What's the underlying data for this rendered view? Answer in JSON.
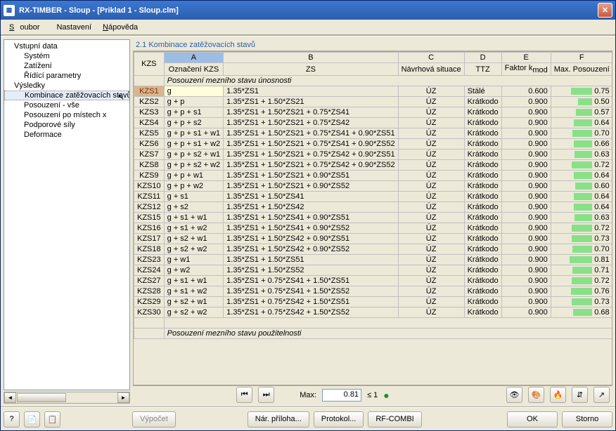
{
  "window": {
    "title": "RX-TIMBER - Sloup - [Priklad 1 - Sloup.clm]"
  },
  "menu": {
    "file": "Soubor",
    "settings": "Nastavení",
    "help": "Nápověda"
  },
  "tree": {
    "t0": "Vstupní data",
    "t1": "Systém",
    "t2": "Zatížení",
    "t3": "Řídící parametry",
    "t4": "Výsledky",
    "t5": "Kombinace zatěžovacích stavů",
    "t6": "Posouzení - vše",
    "t7": "Posouzení po místech x",
    "t8": "Podporové síly",
    "t9": "Deformace"
  },
  "panel_title": "2.1 Kombinace zatěžovacích stavů",
  "headers": {
    "kzs": "KZS",
    "A": "A",
    "B": "B",
    "C": "C",
    "D": "D",
    "E": "E",
    "F": "F",
    "ozn": "Označení KZS",
    "zs": "ZS",
    "ns": "Návrhová situace",
    "ttz": "TTZ",
    "faktor": "Faktor k",
    "faktor_sub": "mod",
    "max": "Max. Posouzení"
  },
  "section1": "Posouzení mezního stavu únosnosti",
  "section2": "Posouzení mezního stavu použitelnosti",
  "rows": [
    {
      "id": "KZS1",
      "a": "g",
      "b": "1.35*ZS1",
      "c": "ÚZ",
      "d": "Stálé",
      "e": "0.600",
      "f": "0.75"
    },
    {
      "id": "KZS2",
      "a": "g + p",
      "b": "1.35*ZS1 + 1.50*ZS21",
      "c": "ÚZ",
      "d": "Krátkodo",
      "e": "0.900",
      "f": "0.50"
    },
    {
      "id": "KZS3",
      "a": "g + p + s1",
      "b": "1.35*ZS1 + 1.50*ZS21 + 0.75*ZS41",
      "c": "ÚZ",
      "d": "Krátkodo",
      "e": "0.900",
      "f": "0.57"
    },
    {
      "id": "KZS4",
      "a": "g + p + s2",
      "b": "1.35*ZS1 + 1.50*ZS21 + 0.75*ZS42",
      "c": "ÚZ",
      "d": "Krátkodo",
      "e": "0.900",
      "f": "0.64"
    },
    {
      "id": "KZS5",
      "a": "g + p + s1 + w1",
      "b": "1.35*ZS1 + 1.50*ZS21 + 0.75*ZS41 + 0.90*ZS51",
      "c": "ÚZ",
      "d": "Krátkodo",
      "e": "0.900",
      "f": "0.70"
    },
    {
      "id": "KZS6",
      "a": "g + p + s1 + w2",
      "b": "1.35*ZS1 + 1.50*ZS21 + 0.75*ZS41 + 0.90*ZS52",
      "c": "ÚZ",
      "d": "Krátkodo",
      "e": "0.900",
      "f": "0.66"
    },
    {
      "id": "KZS7",
      "a": "g + p + s2 + w1",
      "b": "1.35*ZS1 + 1.50*ZS21 + 0.75*ZS42 + 0.90*ZS51",
      "c": "ÚZ",
      "d": "Krátkodo",
      "e": "0.900",
      "f": "0.63"
    },
    {
      "id": "KZS8",
      "a": "g + p + s2 + w2",
      "b": "1.35*ZS1 + 1.50*ZS21 + 0.75*ZS42 + 0.90*ZS52",
      "c": "ÚZ",
      "d": "Krátkodo",
      "e": "0.900",
      "f": "0.72"
    },
    {
      "id": "KZS9",
      "a": "g + p + w1",
      "b": "1.35*ZS1 + 1.50*ZS21 + 0.90*ZS51",
      "c": "ÚZ",
      "d": "Krátkodo",
      "e": "0.900",
      "f": "0.64"
    },
    {
      "id": "KZS10",
      "a": "g + p + w2",
      "b": "1.35*ZS1 + 1.50*ZS21 + 0.90*ZS52",
      "c": "ÚZ",
      "d": "Krátkodo",
      "e": "0.900",
      "f": "0.60"
    },
    {
      "id": "KZS11",
      "a": "g + s1",
      "b": "1.35*ZS1 + 1.50*ZS41",
      "c": "ÚZ",
      "d": "Krátkodo",
      "e": "0.900",
      "f": "0.64"
    },
    {
      "id": "KZS12",
      "a": "g + s2",
      "b": "1.35*ZS1 + 1.50*ZS42",
      "c": "ÚZ",
      "d": "Krátkodo",
      "e": "0.900",
      "f": "0.64"
    },
    {
      "id": "KZS15",
      "a": "g + s1 + w1",
      "b": "1.35*ZS1 + 1.50*ZS41 + 0.90*ZS51",
      "c": "ÚZ",
      "d": "Krátkodo",
      "e": "0.900",
      "f": "0.63"
    },
    {
      "id": "KZS16",
      "a": "g + s1 + w2",
      "b": "1.35*ZS1 + 1.50*ZS41 + 0.90*ZS52",
      "c": "ÚZ",
      "d": "Krátkodo",
      "e": "0.900",
      "f": "0.72"
    },
    {
      "id": "KZS17",
      "a": "g + s2 + w1",
      "b": "1.35*ZS1 + 1.50*ZS42 + 0.90*ZS51",
      "c": "ÚZ",
      "d": "Krátkodo",
      "e": "0.900",
      "f": "0.73"
    },
    {
      "id": "KZS18",
      "a": "g + s2 + w2",
      "b": "1.35*ZS1 + 1.50*ZS42 + 0.90*ZS52",
      "c": "ÚZ",
      "d": "Krátkodo",
      "e": "0.900",
      "f": "0.70"
    },
    {
      "id": "KZS23",
      "a": "g + w1",
      "b": "1.35*ZS1 + 1.50*ZS51",
      "c": "ÚZ",
      "d": "Krátkodo",
      "e": "0.900",
      "f": "0.81"
    },
    {
      "id": "KZS24",
      "a": "g + w2",
      "b": "1.35*ZS1 + 1.50*ZS52",
      "c": "ÚZ",
      "d": "Krátkodo",
      "e": "0.900",
      "f": "0.71"
    },
    {
      "id": "KZS27",
      "a": "g + s1 + w1",
      "b": "1.35*ZS1 + 0.75*ZS41 + 1.50*ZS51",
      "c": "ÚZ",
      "d": "Krátkodo",
      "e": "0.900",
      "f": "0.72"
    },
    {
      "id": "KZS28",
      "a": "g + s1 + w2",
      "b": "1.35*ZS1 + 0.75*ZS41 + 1.50*ZS52",
      "c": "ÚZ",
      "d": "Krátkodo",
      "e": "0.900",
      "f": "0.76"
    },
    {
      "id": "KZS29",
      "a": "g + s2 + w1",
      "b": "1.35*ZS1 + 0.75*ZS42 + 1.50*ZS51",
      "c": "ÚZ",
      "d": "Krátkodo",
      "e": "0.900",
      "f": "0.73"
    },
    {
      "id": "KZS30",
      "a": "g + s2 + w2",
      "b": "1.35*ZS1 + 0.75*ZS42 + 1.50*ZS52",
      "c": "ÚZ",
      "d": "Krátkodo",
      "e": "0.900",
      "f": "0.68"
    }
  ],
  "status": {
    "max_label": "Max:",
    "max_value": "0.81",
    "max_limit": "≤ 1"
  },
  "buttons": {
    "vypocet": "Výpočet",
    "priloha": "Nár. příloha...",
    "protokol": "Protokol...",
    "rfcombi": "RF-COMBI",
    "ok": "OK",
    "storno": "Storno"
  }
}
